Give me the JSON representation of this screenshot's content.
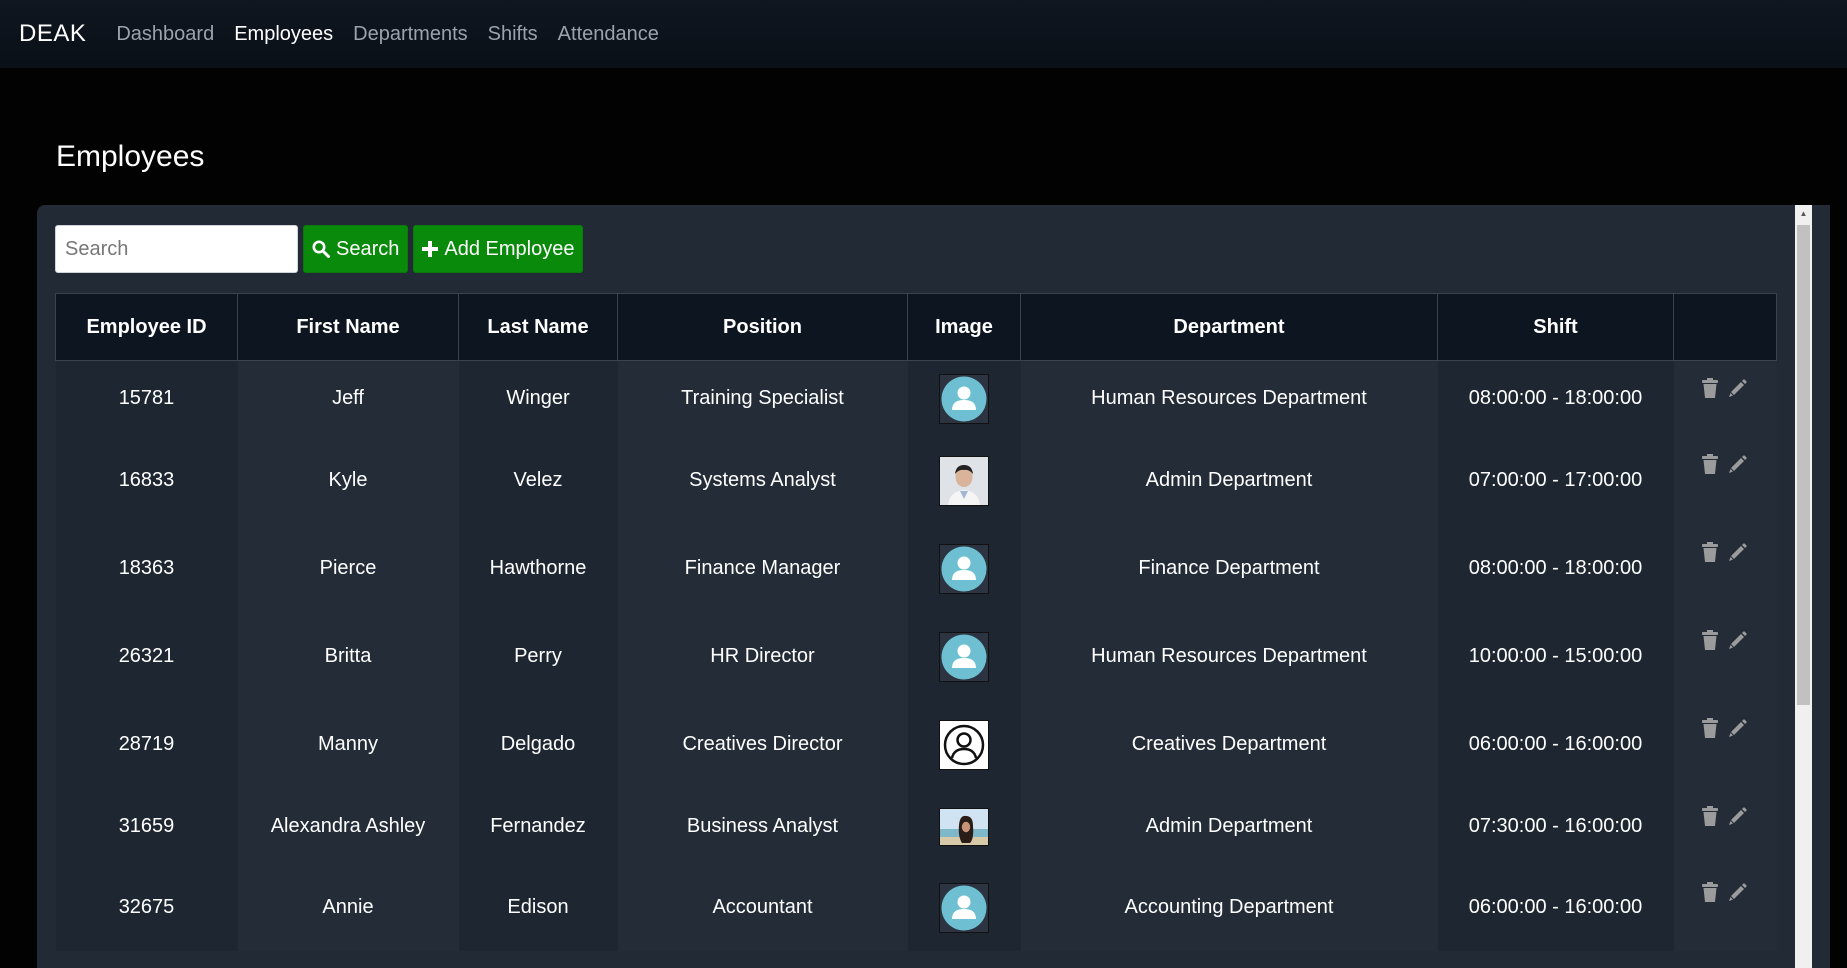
{
  "nav": {
    "brand": "DEAK",
    "links": [
      "Dashboard",
      "Employees",
      "Departments",
      "Shifts",
      "Attendance"
    ]
  },
  "page": {
    "title": "Employees"
  },
  "toolbar": {
    "search_placeholder": "Search",
    "search_label": "Search",
    "add_label": "Add Employee",
    "accent": "#0a8a0a"
  },
  "table": {
    "headers": [
      "Employee ID",
      "First Name",
      "Last Name",
      "Position",
      "Image",
      "Department",
      "Shift",
      ""
    ],
    "rows": [
      {
        "id": "15781",
        "first": "Jeff",
        "last": "Winger",
        "position": "Training Specialist",
        "image": "default-avatar",
        "department": "Human Resources Department",
        "shift": "08:00:00 - 18:00:00"
      },
      {
        "id": "16833",
        "first": "Kyle",
        "last": "Velez",
        "position": "Systems Analyst",
        "image": "photo-portrait",
        "department": "Admin Department",
        "shift": "07:00:00 - 17:00:00"
      },
      {
        "id": "18363",
        "first": "Pierce",
        "last": "Hawthorne",
        "position": "Finance Manager",
        "image": "default-avatar",
        "department": "Finance Department",
        "shift": "08:00:00 - 18:00:00"
      },
      {
        "id": "26321",
        "first": "Britta",
        "last": "Perry",
        "position": "HR Director",
        "image": "default-avatar",
        "department": "Human Resources Department",
        "shift": "10:00:00 - 15:00:00"
      },
      {
        "id": "28719",
        "first": "Manny",
        "last": "Delgado",
        "position": "Creatives Director",
        "image": "outline-avatar",
        "department": "Creatives Department",
        "shift": "06:00:00 - 16:00:00"
      },
      {
        "id": "31659",
        "first": "Alexandra Ashley",
        "last": "Fernandez",
        "position": "Business Analyst",
        "image": "photo-beach",
        "department": "Admin Department",
        "shift": "07:30:00 - 16:00:00"
      },
      {
        "id": "32675",
        "first": "Annie",
        "last": "Edison",
        "position": "Accountant",
        "image": "default-avatar",
        "department": "Accounting Department",
        "shift": "06:00:00 - 16:00:00"
      }
    ]
  }
}
